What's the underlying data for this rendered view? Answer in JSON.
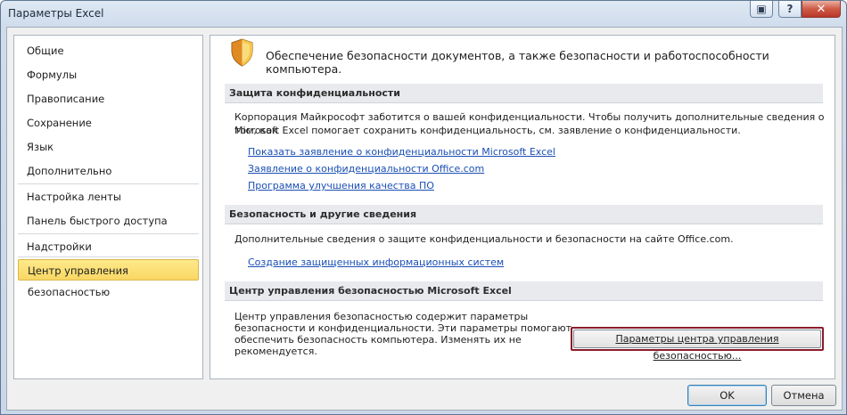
{
  "window": {
    "title": "Параметры Excel",
    "controls": {
      "restore_glyph": "▣",
      "help_glyph": "?",
      "close_glyph": "✕"
    }
  },
  "nav": {
    "items": [
      {
        "label": "Общие",
        "selected": false
      },
      {
        "label": "Формулы",
        "selected": false
      },
      {
        "label": "Правописание",
        "selected": false
      },
      {
        "label": "Сохранение",
        "selected": false
      },
      {
        "label": "Язык",
        "selected": false
      },
      {
        "label": "Дополнительно",
        "selected": false
      },
      {
        "label": "Настройка ленты",
        "selected": false
      },
      {
        "label": "Панель быстрого доступа",
        "selected": false
      },
      {
        "label": "Надстройки",
        "selected": false
      },
      {
        "label": "Центр управления безопасностью",
        "selected": true
      }
    ]
  },
  "main": {
    "header_text": "Обеспечение безопасности документов, а также безопасности и работоспособности компьютера.",
    "header_icon": "shield-icon",
    "sections": [
      {
        "title": "Защита конфиденциальности",
        "text_lines": [
          "Корпорация Майкрософт заботится о вашей конфиденциальности. Чтобы получить дополнительные сведения о том, как",
          "Microsoft Excel помогает сохранить конфиденциальность, см. заявление о конфиденциальности."
        ],
        "links": [
          "Показать заявление о конфиденциальности Microsoft Excel",
          "Заявление о конфиденциальности Office.com",
          "Программа улучшения качества ПО"
        ]
      },
      {
        "title": "Безопасность и другие сведения",
        "text_lines": [
          "Дополнительные сведения о защите конфиденциальности и безопасности на сайте Office.com."
        ],
        "links": [
          "Создание защищенных информационных систем"
        ]
      },
      {
        "title": "Центр управления безопасностью Microsoft Excel",
        "text_lines": [
          "Центр управления безопасностью содержит параметры",
          "безопасности и конфиденциальности. Эти параметры помогают",
          "обеспечить безопасность компьютера. Изменять их не",
          "рекомендуется."
        ],
        "button_label": "Параметры центра управления безопасностью..."
      }
    ]
  },
  "footer": {
    "ok_label": "OK",
    "cancel_label": "Отмена"
  },
  "colors": {
    "accent_selected": "#fad764",
    "link": "#1a4fb5",
    "focus_border": "#8b1c2a"
  }
}
